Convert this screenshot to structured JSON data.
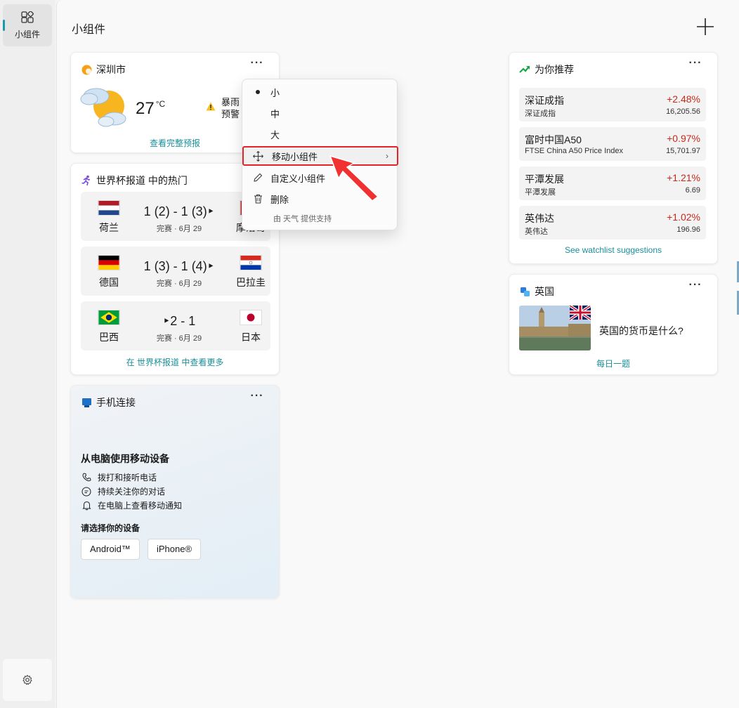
{
  "rail": {
    "widgets_label": "小组件"
  },
  "header": {
    "title": "小组件"
  },
  "weather": {
    "city": "深圳市",
    "temp": "27",
    "unit": "°C",
    "alert_line1": "暴雨",
    "alert_line2": "预警",
    "link": "查看完整预报"
  },
  "worldcup": {
    "title": "世界杯报道 中的热门",
    "matches": [
      {
        "home": "荷兰",
        "away": "摩洛哥",
        "score": "1 (2) - 1 (3)‣",
        "status": "完赛 · 6月 29"
      },
      {
        "home": "德国",
        "away": "巴拉圭",
        "score": "1 (3) - 1 (4)‣",
        "status": "完赛 · 6月 29"
      },
      {
        "home": "巴西",
        "away": "日本",
        "score": "‣2 - 1",
        "status": "完赛 · 6月 29"
      }
    ],
    "link": "在 世界杯报道 中查看更多"
  },
  "phone": {
    "title": "手机连接",
    "headline": "从电脑使用移动设备",
    "features": [
      "拨打和接听电话",
      "持续关注你的对话",
      "在电脑上查看移动通知"
    ],
    "choose": "请选择你的设备",
    "android": "Android™",
    "iphone": "iPhone®"
  },
  "stocks": {
    "title": "为你推荐",
    "items": [
      {
        "name": "深证成指",
        "sub": "深证成指",
        "change": "+2.48%",
        "price": "16,205.56"
      },
      {
        "name": "富时中国A50",
        "sub": "FTSE China A50 Price Index",
        "change": "+0.97%",
        "price": "15,701.97"
      },
      {
        "name": "平潭发展",
        "sub": "平潭发展",
        "change": "+1.21%",
        "price": "6.69"
      },
      {
        "name": "英伟达",
        "sub": "英伟达",
        "change": "+1.02%",
        "price": "196.96"
      }
    ],
    "link": "See watchlist suggestions"
  },
  "uk": {
    "title": "英国",
    "question": "英国的货币是什么?",
    "link": "每日一题"
  },
  "menu": {
    "small": "小",
    "medium": "中",
    "large": "大",
    "move": "移动小组件",
    "customize": "自定义小组件",
    "delete": "删除",
    "footer": "由 天气 提供支持"
  },
  "colors": {
    "accent": "#1a8f99",
    "positive": "#c42b1c",
    "highlight": "#e3242b"
  }
}
